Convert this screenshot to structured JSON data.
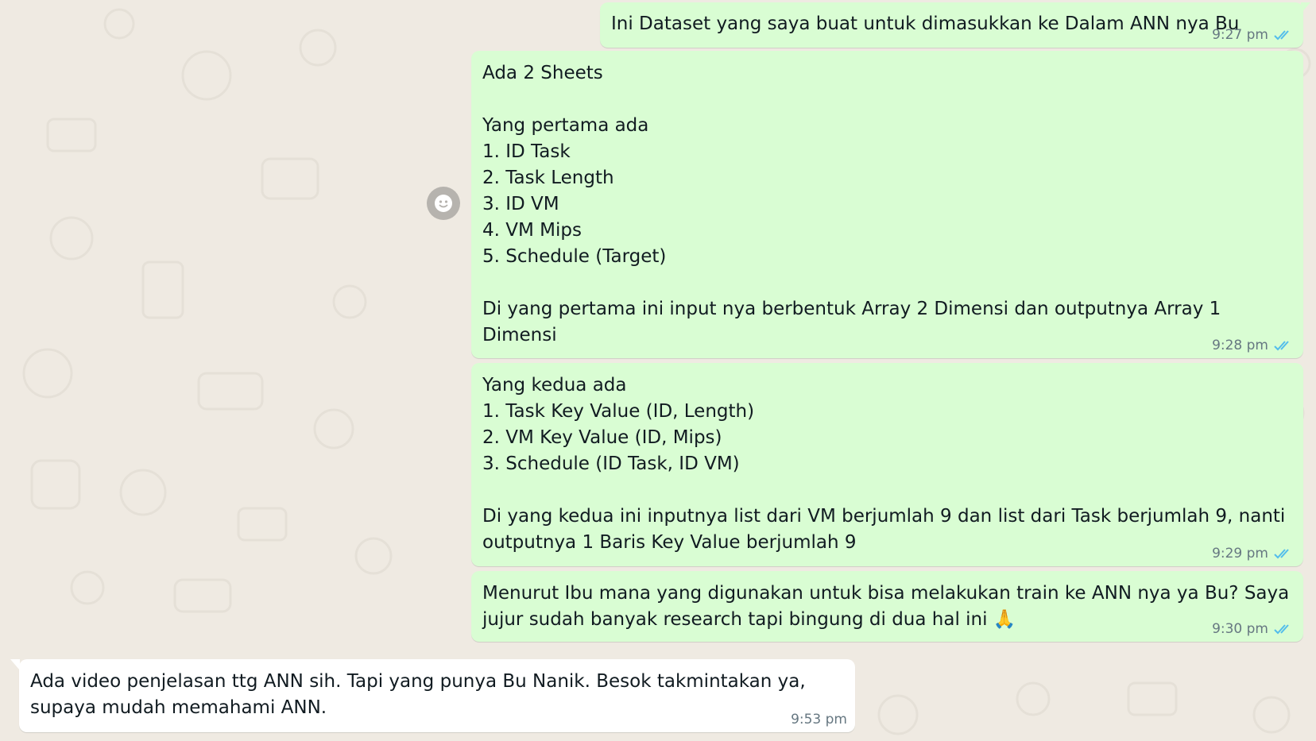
{
  "theme": {
    "background": "#efeae2",
    "outgoing_bubble": "#d9fdd3",
    "incoming_bubble": "#ffffff",
    "read_tick_color": "#53bdeb",
    "meta_color": "#667781"
  },
  "messages": [
    {
      "direction": "outgoing",
      "text": "Ini Dataset yang saya buat untuk dimasukkan ke Dalam ANN nya Bu",
      "time": "9:27 pm",
      "status_icon": "double-check-read-icon"
    },
    {
      "direction": "outgoing",
      "text": "Ada 2 Sheets\n\nYang pertama ada\n1. ID Task\n2. Task Length\n3. ID VM\n4. VM Mips\n5. Schedule (Target)\n\nDi yang pertama ini input nya berbentuk Array 2 Dimensi dan outputnya Array 1 Dimensi",
      "time": "9:28 pm",
      "status_icon": "double-check-read-icon"
    },
    {
      "direction": "outgoing",
      "text": "Yang kedua ada\n1. Task Key Value (ID, Length)\n2. VM Key Value (ID, Mips)\n3. Schedule (ID Task, ID VM)\n\nDi yang kedua ini inputnya list dari VM berjumlah 9 dan list dari Task berjumlah 9, nanti outputnya 1 Baris Key Value berjumlah 9",
      "time": "9:29 pm",
      "status_icon": "double-check-read-icon"
    },
    {
      "direction": "outgoing",
      "text": "Menurut Ibu mana yang digunakan untuk bisa melakukan train ke ANN nya ya Bu? Saya jujur sudah banyak research tapi bingung di dua hal ini 🙏",
      "time": "9:30 pm",
      "status_icon": "double-check-read-icon"
    },
    {
      "direction": "incoming",
      "text": "Ada video penjelasan ttg ANN sih. Tapi yang punya Bu Nanik. Besok takmintakan ya, supaya mudah memahami ANN.",
      "time": "9:53 pm"
    }
  ],
  "reaction_button": {
    "icon": "smiley-icon"
  }
}
